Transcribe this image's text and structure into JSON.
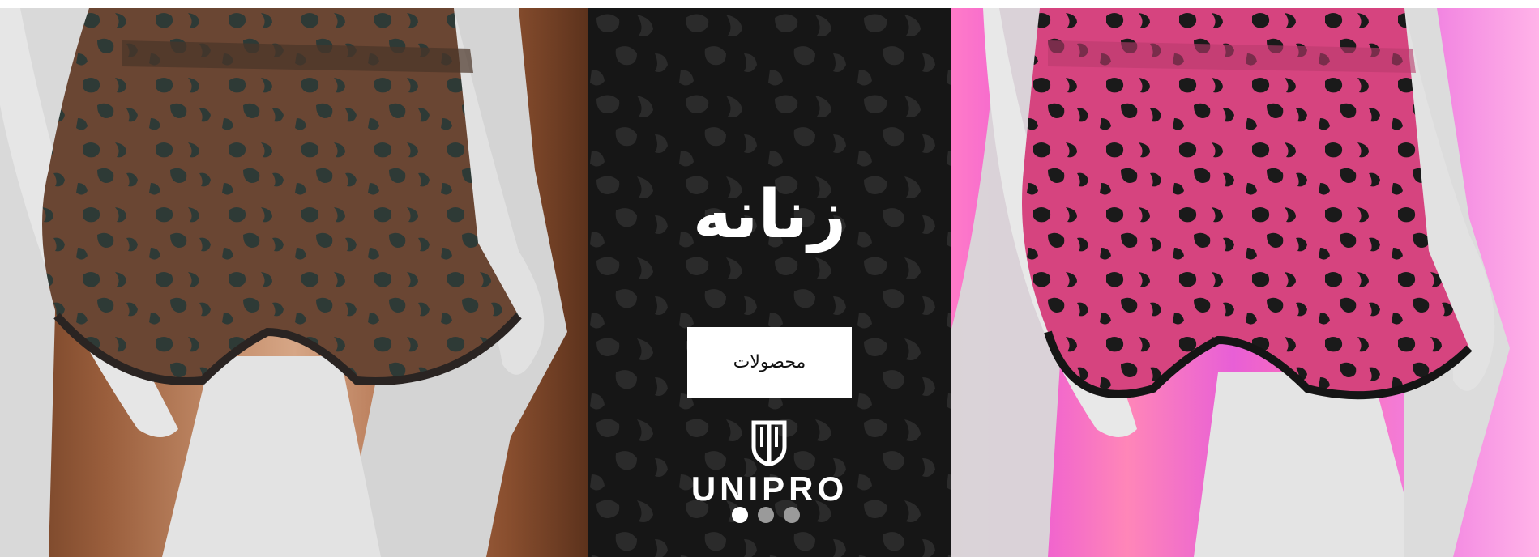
{
  "hero": {
    "title": "زنانه",
    "cta_label": "محصولات",
    "brand": "UNIPRO",
    "slides": [
      {
        "state": "active"
      },
      {
        "state": "inactive"
      },
      {
        "state": "inactive"
      }
    ]
  },
  "colors": {
    "left_backdrop": "#9a5e3c",
    "center_backdrop": "#111111",
    "right_backdrop": "#ee5ed2",
    "pink_print": "#d6447f",
    "brown_print": "#5e3b2a"
  },
  "icons": [
    "unipro-logo-icon"
  ]
}
